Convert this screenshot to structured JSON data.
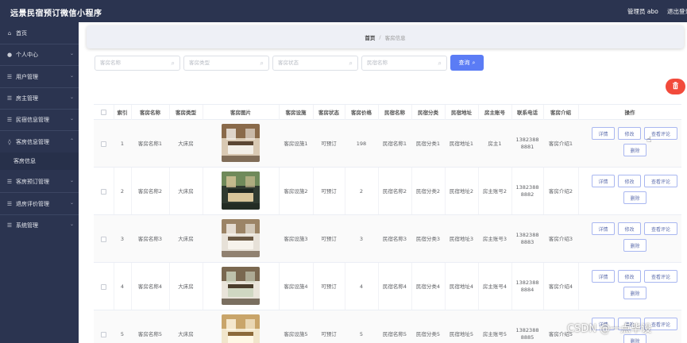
{
  "header": {
    "title": "远景民宿预订微信小程序",
    "admin": "管理员 abo",
    "logout": "退出登录"
  },
  "sidebar": {
    "items": [
      {
        "label": "首页",
        "icon": "home-icon",
        "glyph": "⌂"
      },
      {
        "label": "个人中心",
        "icon": "user-icon",
        "glyph": "●"
      },
      {
        "label": "用户管理",
        "icon": "menu-icon",
        "glyph": "☰"
      },
      {
        "label": "房主管理",
        "icon": "menu-icon",
        "glyph": "☰"
      },
      {
        "label": "民宿信息管理",
        "icon": "menu-icon",
        "glyph": "☰"
      },
      {
        "label": "客房信息管理",
        "icon": "pin-icon",
        "glyph": "◊"
      },
      {
        "label": "客房预订管理",
        "icon": "menu-icon",
        "glyph": "☰"
      },
      {
        "label": "退房评价管理",
        "icon": "menu-icon",
        "glyph": "☰"
      },
      {
        "label": "系统管理",
        "icon": "menu-icon",
        "glyph": "☰"
      }
    ],
    "sub_item": "客房信息"
  },
  "breadcrumb": {
    "home": "首页",
    "separator": "/",
    "current": "客房信息"
  },
  "filters": {
    "room_name": "客房名称",
    "room_type": "客房类型",
    "room_status": "客房状态",
    "homestay_name": "民宿名称",
    "search_label": "查询"
  },
  "table": {
    "headers": [
      "索引",
      "客房名称",
      "客房类型",
      "客房图片",
      "客房设施",
      "客房状态",
      "客房价格",
      "民宿名称",
      "民宿分类",
      "民宿地址",
      "房主账号",
      "联系电话",
      "客房介绍",
      "操作"
    ],
    "actions": {
      "detail": "详情",
      "edit": "修改",
      "comments": "查看评论",
      "delete": "删除"
    },
    "rows": [
      {
        "index": "1",
        "name": "客房名称1",
        "type": "大床房",
        "facilities": "客房设施1",
        "status": "可预订",
        "price": "198",
        "homestay": "民宿名称1",
        "category": "民宿分类1",
        "address": "民宿地址1",
        "owner": "房主1",
        "phone1": "1382388",
        "phone2": "8881",
        "intro": "客房介绍1"
      },
      {
        "index": "2",
        "name": "客房名称2",
        "type": "大床房",
        "facilities": "客房设施2",
        "status": "可预订",
        "price": "2",
        "homestay": "民宿名称2",
        "category": "民宿分类2",
        "address": "民宿地址2",
        "owner": "房主账号2",
        "phone1": "1382388",
        "phone2": "8882",
        "intro": "客房介绍2"
      },
      {
        "index": "3",
        "name": "客房名称3",
        "type": "大床房",
        "facilities": "客房设施3",
        "status": "可预订",
        "price": "3",
        "homestay": "民宿名称3",
        "category": "民宿分类3",
        "address": "民宿地址3",
        "owner": "房主账号3",
        "phone1": "1382388",
        "phone2": "8883",
        "intro": "客房介绍3"
      },
      {
        "index": "4",
        "name": "客房名称4",
        "type": "大床房",
        "facilities": "客房设施4",
        "status": "可预订",
        "price": "4",
        "homestay": "民宿名称4",
        "category": "民宿分类4",
        "address": "民宿地址4",
        "owner": "房主账号4",
        "phone1": "1382388",
        "phone2": "8884",
        "intro": "客房介绍4"
      },
      {
        "index": "5",
        "name": "客房名称5",
        "type": "大床房",
        "facilities": "客房设施5",
        "status": "可预订",
        "price": "5",
        "homestay": "民宿名称5",
        "category": "民宿分类5",
        "address": "民宿地址5",
        "owner": "房主账号5",
        "phone1": "1382388",
        "phone2": "8885",
        "intro": "客房介绍5"
      }
    ]
  },
  "watermark": "CSDN @一点毕设",
  "colors": {
    "sidebar": "#2b3450",
    "primary": "#5b7cf5",
    "danger": "#f24a3b"
  }
}
